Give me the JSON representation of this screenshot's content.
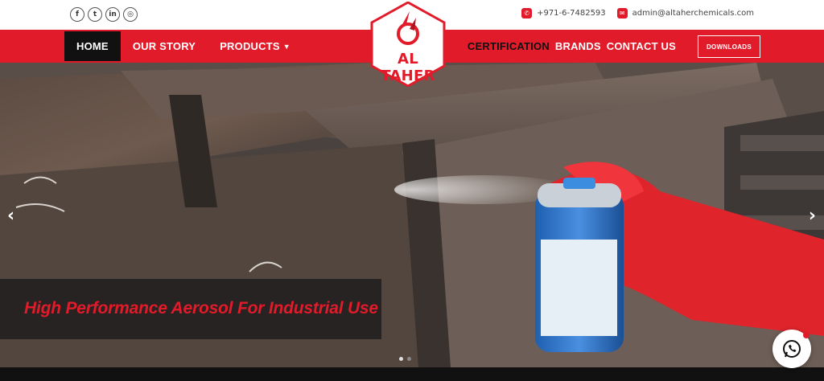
{
  "brand": {
    "name": "AL TAHER",
    "accent": "#e21b2a"
  },
  "social": [
    {
      "icon": "facebook-icon",
      "glyph": "f"
    },
    {
      "icon": "twitter-icon",
      "glyph": "t"
    },
    {
      "icon": "linkedin-icon",
      "glyph": "in"
    },
    {
      "icon": "instagram-icon",
      "glyph": "◎"
    }
  ],
  "contact": {
    "phone": "+971-6-7482593",
    "email": "admin@altaherchemicals.com"
  },
  "nav": {
    "left": [
      {
        "label": "HOME",
        "active": true
      },
      {
        "label": "OUR STORY"
      },
      {
        "label": "PRODUCTS",
        "has_dropdown": true
      }
    ],
    "right": [
      {
        "label": "CERTIFICATION"
      },
      {
        "label": "BRANDS"
      },
      {
        "label": "CONTACT US"
      }
    ],
    "downloads": "DOWNLOADS"
  },
  "hero": {
    "caption": "High Performance Aerosol For Industrial Use",
    "prev_glyph": "‹",
    "next_glyph": "›",
    "slides": 2,
    "active_slide": 1
  }
}
